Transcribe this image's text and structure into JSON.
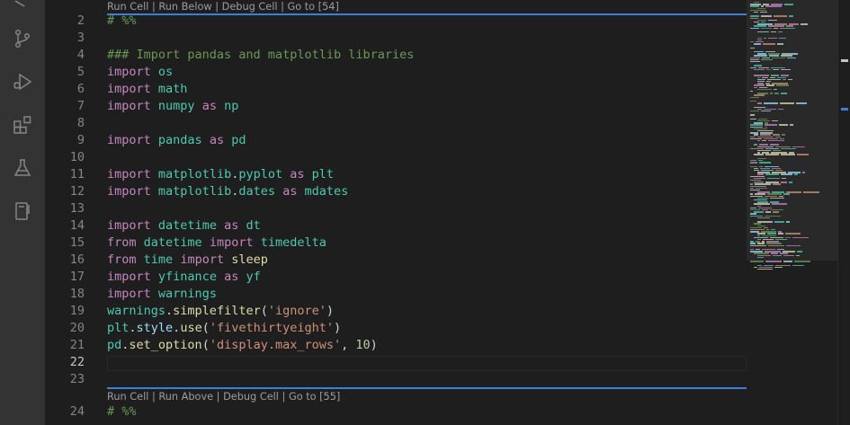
{
  "activity_bar": {
    "icons": [
      "source-control-icon",
      "run-debug-icon",
      "extensions-icon",
      "testing-icon",
      "notebook-icon"
    ]
  },
  "codelens_top": {
    "run_cell": "Run Cell",
    "sep1": " | ",
    "run_below": "Run Below",
    "sep2": " | ",
    "debug_cell": "Debug Cell",
    "sep3": " | ",
    "goto": "Go to [54]"
  },
  "codelens_bottom": {
    "run_cell": "Run Cell",
    "sep1": " | ",
    "run_above": "Run Above",
    "sep2": " | ",
    "debug_cell": "Debug Cell",
    "sep3": " | ",
    "goto": "Go to [55]"
  },
  "code_lines": [
    {
      "n": "2",
      "tokens": [
        [
          "cmt",
          "# %%"
        ]
      ]
    },
    {
      "n": "3",
      "tokens": []
    },
    {
      "n": "4",
      "tokens": [
        [
          "cmt",
          "### Import pandas and matplotlib libraries"
        ]
      ]
    },
    {
      "n": "5",
      "tokens": [
        [
          "kw",
          "import"
        ],
        [
          "plain",
          " "
        ],
        [
          "mod",
          "os"
        ]
      ]
    },
    {
      "n": "6",
      "tokens": [
        [
          "kw",
          "import"
        ],
        [
          "plain",
          " "
        ],
        [
          "mod",
          "math"
        ]
      ]
    },
    {
      "n": "7",
      "tokens": [
        [
          "kw",
          "import"
        ],
        [
          "plain",
          " "
        ],
        [
          "mod",
          "numpy"
        ],
        [
          "plain",
          " "
        ],
        [
          "kw",
          "as"
        ],
        [
          "plain",
          " "
        ],
        [
          "mod",
          "np"
        ]
      ]
    },
    {
      "n": "8",
      "tokens": []
    },
    {
      "n": "9",
      "tokens": [
        [
          "kw",
          "import"
        ],
        [
          "plain",
          " "
        ],
        [
          "mod",
          "pandas"
        ],
        [
          "plain",
          " "
        ],
        [
          "kw",
          "as"
        ],
        [
          "plain",
          " "
        ],
        [
          "mod",
          "pd"
        ]
      ]
    },
    {
      "n": "10",
      "tokens": []
    },
    {
      "n": "11",
      "tokens": [
        [
          "kw",
          "import"
        ],
        [
          "plain",
          " "
        ],
        [
          "mod",
          "matplotlib"
        ],
        [
          "plain",
          "."
        ],
        [
          "mod",
          "pyplot"
        ],
        [
          "plain",
          " "
        ],
        [
          "kw",
          "as"
        ],
        [
          "plain",
          " "
        ],
        [
          "mod",
          "plt"
        ]
      ]
    },
    {
      "n": "12",
      "tokens": [
        [
          "kw",
          "import"
        ],
        [
          "plain",
          " "
        ],
        [
          "mod",
          "matplotlib"
        ],
        [
          "plain",
          "."
        ],
        [
          "mod",
          "dates"
        ],
        [
          "plain",
          " "
        ],
        [
          "kw",
          "as"
        ],
        [
          "plain",
          " "
        ],
        [
          "mod",
          "mdates"
        ]
      ]
    },
    {
      "n": "13",
      "tokens": []
    },
    {
      "n": "14",
      "tokens": [
        [
          "kw",
          "import"
        ],
        [
          "plain",
          " "
        ],
        [
          "mod",
          "datetime"
        ],
        [
          "plain",
          " "
        ],
        [
          "kw",
          "as"
        ],
        [
          "plain",
          " "
        ],
        [
          "mod",
          "dt"
        ]
      ]
    },
    {
      "n": "15",
      "tokens": [
        [
          "kw",
          "from"
        ],
        [
          "plain",
          " "
        ],
        [
          "mod",
          "datetime"
        ],
        [
          "plain",
          " "
        ],
        [
          "kw",
          "import"
        ],
        [
          "plain",
          " "
        ],
        [
          "mod",
          "timedelta"
        ]
      ]
    },
    {
      "n": "16",
      "tokens": [
        [
          "kw",
          "from"
        ],
        [
          "plain",
          " "
        ],
        [
          "mod",
          "time"
        ],
        [
          "plain",
          " "
        ],
        [
          "kw",
          "import"
        ],
        [
          "plain",
          " "
        ],
        [
          "fn",
          "sleep"
        ]
      ]
    },
    {
      "n": "17",
      "tokens": [
        [
          "kw",
          "import"
        ],
        [
          "plain",
          " "
        ],
        [
          "mod",
          "yfinance"
        ],
        [
          "plain",
          " "
        ],
        [
          "kw",
          "as"
        ],
        [
          "plain",
          " "
        ],
        [
          "mod",
          "yf"
        ]
      ]
    },
    {
      "n": "18",
      "tokens": [
        [
          "kw",
          "import"
        ],
        [
          "plain",
          " "
        ],
        [
          "mod",
          "warnings"
        ]
      ]
    },
    {
      "n": "19",
      "tokens": [
        [
          "mod",
          "warnings"
        ],
        [
          "plain",
          "."
        ],
        [
          "fn",
          "simplefilter"
        ],
        [
          "plain",
          "("
        ],
        [
          "str",
          "'ignore'"
        ],
        [
          "plain",
          ")"
        ]
      ]
    },
    {
      "n": "20",
      "tokens": [
        [
          "mod",
          "plt"
        ],
        [
          "plain",
          "."
        ],
        [
          "var",
          "style"
        ],
        [
          "plain",
          "."
        ],
        [
          "fn",
          "use"
        ],
        [
          "plain",
          "("
        ],
        [
          "str",
          "'fivethirtyeight'"
        ],
        [
          "plain",
          ")"
        ]
      ]
    },
    {
      "n": "21",
      "tokens": [
        [
          "mod",
          "pd"
        ],
        [
          "plain",
          "."
        ],
        [
          "fn",
          "set_option"
        ],
        [
          "plain",
          "("
        ],
        [
          "str",
          "'display.max_rows'"
        ],
        [
          "plain",
          ", "
        ],
        [
          "num",
          "10"
        ],
        [
          "plain",
          ")"
        ]
      ]
    },
    {
      "n": "22",
      "tokens": [],
      "active": true
    },
    {
      "n": "23",
      "tokens": []
    },
    {
      "n": "24",
      "tokens": [
        [
          "cmt",
          "# %%"
        ]
      ]
    }
  ],
  "colors": {
    "accent": "#3b7fd6",
    "keyword": "#c586c0",
    "module": "#4ec9b0",
    "function": "#dcdcaa",
    "string": "#ce9178",
    "number": "#b5cea8",
    "comment": "#6a9955"
  }
}
